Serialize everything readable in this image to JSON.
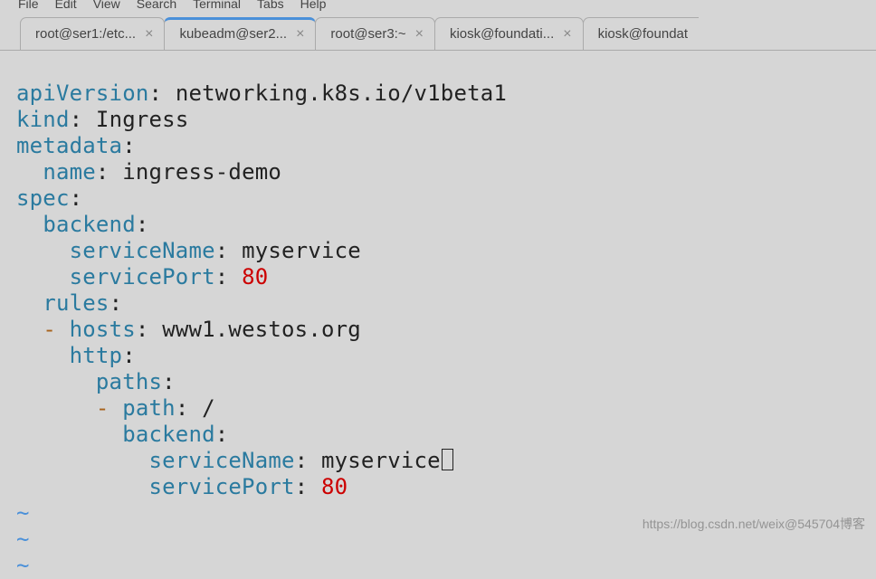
{
  "menubar": {
    "file": "File",
    "edit": "Edit",
    "view": "View",
    "search": "Search",
    "terminal": "Terminal",
    "tabs": "Tabs",
    "help": "Help"
  },
  "tabs": [
    {
      "label": "root@ser1:/etc..."
    },
    {
      "label": "kubeadm@ser2..."
    },
    {
      "label": "root@ser3:~"
    },
    {
      "label": "kiosk@foundati..."
    },
    {
      "label": "kiosk@foundat"
    }
  ],
  "yaml": {
    "apiVersion": {
      "key": "apiVersion",
      "value": "networking.k8s.io/v1beta1"
    },
    "kind": {
      "key": "kind",
      "value": "Ingress"
    },
    "metadata": {
      "key": "metadata",
      "name_key": "name",
      "name_value": "ingress-demo"
    },
    "spec": {
      "key": "spec",
      "backend": {
        "key": "backend",
        "serviceName_key": "serviceName",
        "serviceName_value": "myservice",
        "servicePort_key": "servicePort",
        "servicePort_value": "80"
      },
      "rules": {
        "key": "rules",
        "hosts_key": "hosts",
        "hosts_value": "www1.westos.org",
        "http_key": "http",
        "paths_key": "paths",
        "path_key": "path",
        "path_value": "/",
        "backend_key": "backend",
        "serviceName_key": "serviceName",
        "serviceName_value": "myservice",
        "servicePort_key": "servicePort",
        "servicePort_value": "80"
      }
    }
  },
  "tilde": "~",
  "dash": "-",
  "watermark": "https://blog.csdn.net/weix@545704博客"
}
